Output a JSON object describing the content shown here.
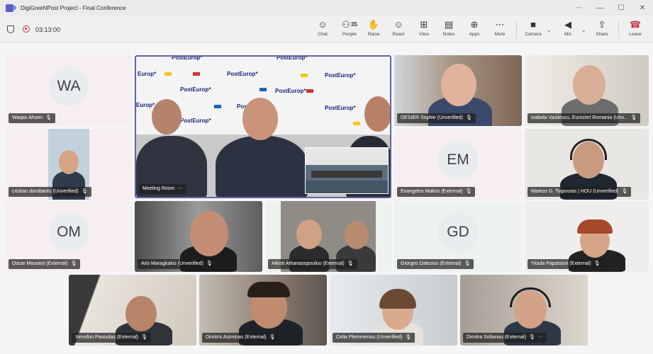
{
  "window": {
    "title": "DigiGreeNPost Project - Final Conference",
    "controls": [
      "⋯",
      "—",
      "☐",
      "✕"
    ]
  },
  "toolbar": {
    "timer": "03:13:00",
    "chat_label": "Chat",
    "people_label": "People",
    "people_count": "35",
    "raise_label": "Raise",
    "react_label": "React",
    "view_label": "View",
    "notes_label": "Notes",
    "apps_label": "Apps",
    "more_label": "More",
    "camera_label": "Camera",
    "mic_label": "Mic",
    "share_label": "Share",
    "leave_label": "Leave"
  },
  "icons": {
    "chat": "☺",
    "people": "⚇",
    "raise": "✋",
    "react": "☺",
    "view": "⊞",
    "notes": "▤",
    "apps": "⊕",
    "more": "⋯",
    "camera": "■",
    "mic": "◀",
    "share": "⇪",
    "leave": "☎",
    "chevron": "⌄",
    "tile_mic": "🎙"
  },
  "backdrop": {
    "brand": "PostEurop*",
    "brand_short": "Europ*"
  },
  "participants": {
    "waqas": {
      "initials": "WA",
      "name": "Waqas Ahsen"
    },
    "meeting_room": {
      "name": "Meeting Room",
      "more": "⋯"
    },
    "desier": {
      "name": "DESIER Sophie (Unverified)"
    },
    "izabela": {
      "name": "Izabela Vasilescu, Eurocert Romania (Unv..."
    },
    "cristian": {
      "name": "cristian.dorobantu (Unverified)"
    },
    "evangelos": {
      "initials": "EM",
      "name": "Evangelos Makris (External)"
    },
    "markos": {
      "name": "Markos G. Tsipouras | HOU (Unverified)"
    },
    "oscar": {
      "initials": "OM",
      "name": "Oscar Mourant (External)"
    },
    "aris": {
      "name": "Aris Maragkakis (Unverified)"
    },
    "alkisti": {
      "name": "Alkisti Athanasopoulou (External)"
    },
    "giorgos": {
      "initials": "GD",
      "name": "Giorgos Dalezios (External)"
    },
    "yioula": {
      "name": "Yioula Papatsiori (External)"
    },
    "xenofon": {
      "name": "Xenofon Pasoulas (External)"
    },
    "dimitris": {
      "name": "Dimitris Asiminas (External)"
    },
    "celia": {
      "name": "Celia Plemmenou (Unverified)"
    },
    "dimitra": {
      "name": "Dimitra Sofianou (External)",
      "more": "⋯"
    }
  },
  "colors": {
    "accent": "#6264a7",
    "leave": "#c4314b",
    "recording": "#c4314b"
  }
}
